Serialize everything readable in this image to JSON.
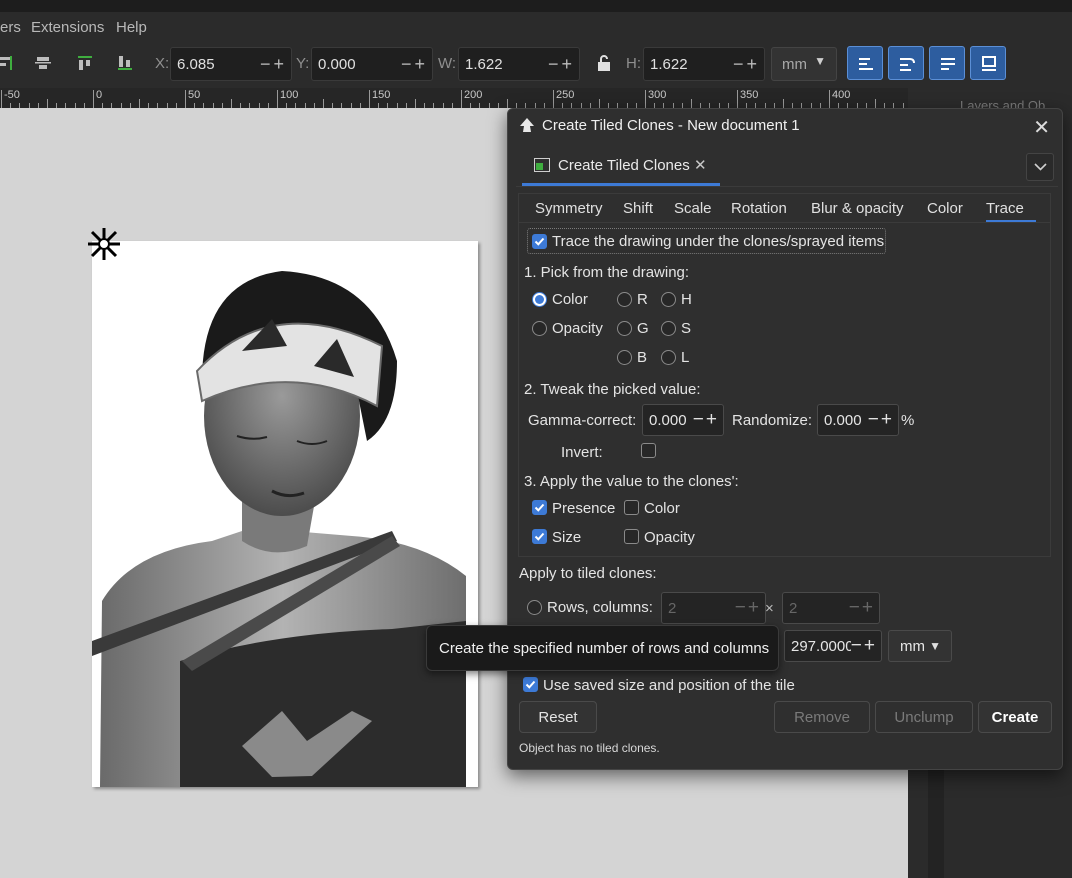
{
  "menu": {
    "partial_item": "ers",
    "extensions": "Extensions",
    "help": "Help"
  },
  "toolbar": {
    "x_label": "X:",
    "x_value": "6.085",
    "y_label": "Y:",
    "y_value": "0.000",
    "w_label": "W:",
    "w_value": "1.622",
    "h_label": "H:",
    "h_value": "1.622",
    "unit": "mm"
  },
  "ruler": {
    "labels": [
      "-50",
      "0",
      "50",
      "100",
      "150",
      "200",
      "250",
      "300",
      "350",
      "400"
    ]
  },
  "right_panel": {
    "title_partial": "Layers and Ob"
  },
  "dialog": {
    "title": "Create Tiled Clones - New document 1",
    "dock_tab": "Create Tiled Clones",
    "tabs": [
      "Symmetry",
      "Shift",
      "Scale",
      "Rotation",
      "Blur & opacity",
      "Color",
      "Trace"
    ],
    "active_tab": "Trace",
    "trace_checkbox": "Trace the drawing under the clones/sprayed items",
    "section1": "1. Pick from the drawing:",
    "pick": {
      "color": "Color",
      "opacity": "Opacity",
      "r": "R",
      "g": "G",
      "b": "B",
      "h": "H",
      "s": "S",
      "l": "L"
    },
    "section2": "2. Tweak the picked value:",
    "gamma_label": "Gamma-correct:",
    "gamma_value": "0.000",
    "randomize_label": "Randomize:",
    "randomize_value": "0.000",
    "percent": "%",
    "invert_label": "Invert:",
    "section3": "3. Apply the value to the clones':",
    "apply": {
      "presence": "Presence",
      "size": "Size",
      "color": "Color",
      "opacity": "Opacity"
    },
    "apply_to_tiled": "Apply to tiled clones:",
    "rows_cols_label": "Rows, columns:",
    "rows_value": "2",
    "cols_value": "2",
    "times": "×",
    "height_value": "297.0000",
    "width_hidden_value": "-",
    "times2": "×",
    "size_unit": "mm",
    "use_saved": "Use saved size and position of the tile",
    "buttons": {
      "reset": "Reset",
      "remove": "Remove",
      "unclump": "Unclump",
      "create": "Create"
    },
    "status": "Object has no tiled clones."
  },
  "tooltip": "Create the specified number of rows and columns"
}
